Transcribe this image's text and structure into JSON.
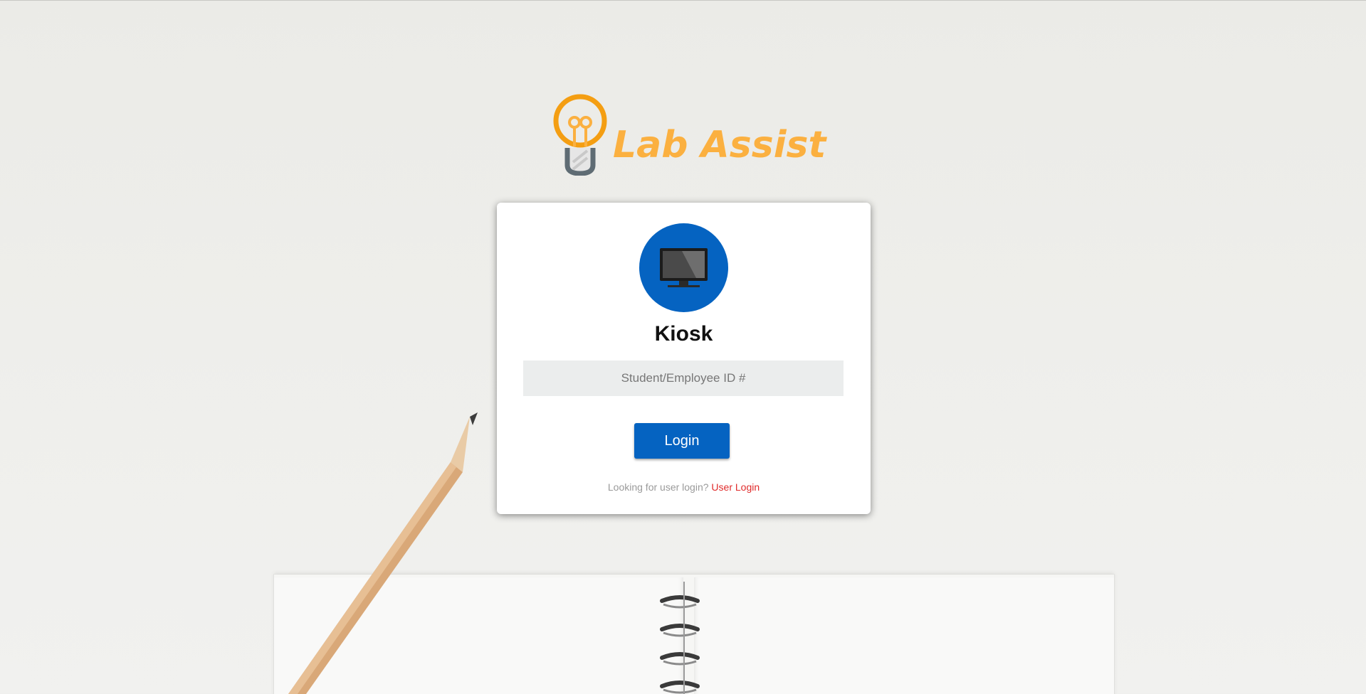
{
  "brand": {
    "name": "Lab Assist",
    "logo_icon": "lightbulb-icon",
    "color": "#fbb040"
  },
  "card": {
    "avatar_icon": "monitor-icon",
    "title": "Kiosk",
    "id_field": {
      "placeholder": "Student/Employee ID #",
      "value": ""
    },
    "login_label": "Login",
    "footer_prompt": "Looking for user login?",
    "user_login_link": "User Login"
  },
  "colors": {
    "primary": "#0563c1",
    "link": "#e02b2b",
    "input_bg": "#ebeded"
  }
}
